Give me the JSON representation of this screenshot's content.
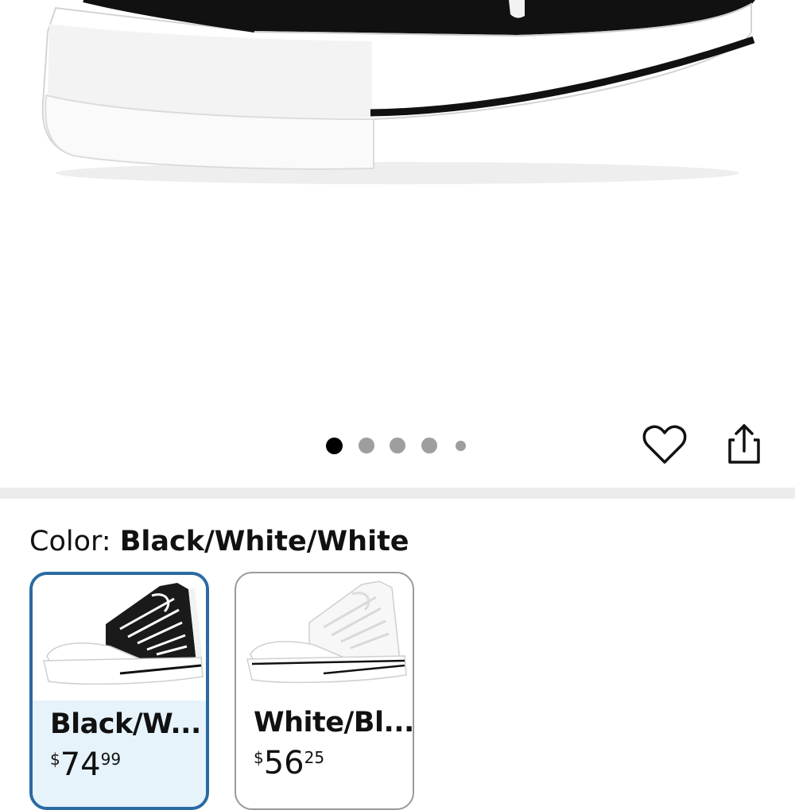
{
  "product": {
    "image_alt": "Black canvas high-top platform sneaker",
    "carousel": {
      "count": 5,
      "active_index": 0
    }
  },
  "actions": {
    "favorite_icon": "heart-outline-icon",
    "share_icon": "share-icon"
  },
  "color": {
    "label": "Color: ",
    "selected_value": "Black/White/White"
  },
  "swatches": [
    {
      "name": "Black/W...",
      "currency": "$",
      "price_whole": "74",
      "price_fraction": "99",
      "selected": true
    },
    {
      "name": "White/Bl...",
      "currency": "$",
      "price_whole": "56",
      "price_fraction": "25",
      "selected": false
    }
  ],
  "colors": {
    "selected_border": "#2a6aa3",
    "selected_bg": "#e6f3fb",
    "dot_active": "#000000",
    "dot_inactive": "#9e9e9e",
    "divider": "#ececec"
  }
}
